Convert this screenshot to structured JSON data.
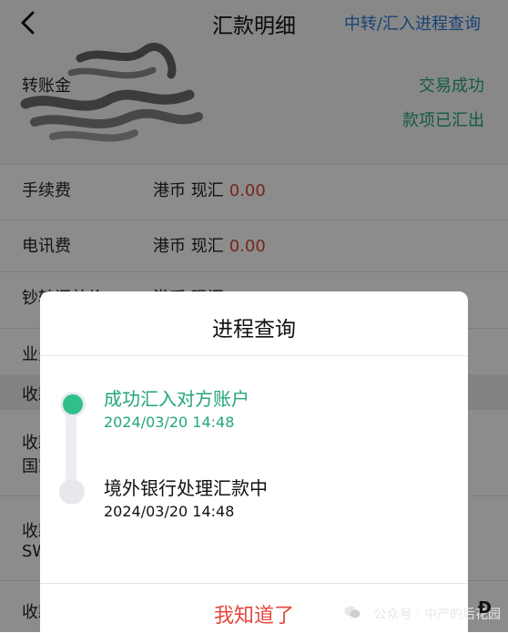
{
  "header": {
    "title": "汇款明细",
    "link": "中转/汇入进程查询"
  },
  "top": {
    "amount_label": "转账金",
    "status_primary": "交易成功",
    "status_secondary": "款项已汇出"
  },
  "rows": [
    {
      "label": "手续费",
      "currency": "港币 现汇",
      "amount": "0.00"
    },
    {
      "label": "电讯费",
      "currency": "港币 现汇",
      "amount": "0.00"
    },
    {
      "label": "钞转汇差价",
      "currency": "港币 现汇"
    }
  ],
  "business_label": "业务",
  "section_label": "收款",
  "payee_block1": {
    "line1": "收款",
    "line2": "国家"
  },
  "payee_block2": {
    "line1": "收款",
    "line2": "SW"
  },
  "payee_block3": {
    "line1": "收款"
  },
  "modal": {
    "title": "进程查询",
    "steps": [
      {
        "title": "成功汇入对方账户",
        "time": "2024/03/20 14:48",
        "status": "done"
      },
      {
        "title": "境外银行处理汇款中",
        "time": "2024/03/20 14:48",
        "status": "pending"
      }
    ],
    "ok_label": "我知道了"
  },
  "watermark": {
    "text": "公众号 · 中产的后花园",
    "edge_glyph": "Đ"
  },
  "colors": {
    "success": "#24a675",
    "link": "#2a7bd6",
    "amount": "#d9453b",
    "ok": "#e5473c"
  }
}
